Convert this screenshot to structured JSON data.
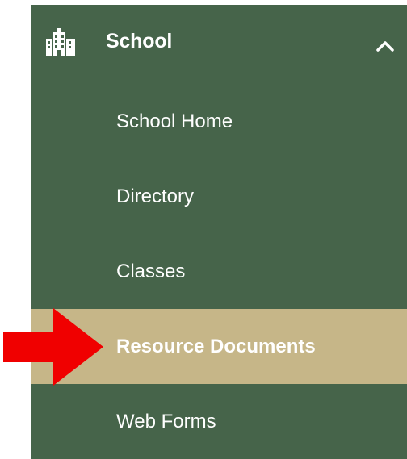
{
  "sidebar": {
    "section": {
      "title": "School",
      "icon": "building-icon",
      "expanded": true,
      "chevron": "chevron-up-icon"
    },
    "items": [
      {
        "label": "School Home",
        "active": false
      },
      {
        "label": "Directory",
        "active": false
      },
      {
        "label": "Classes",
        "active": false
      },
      {
        "label": "Resource Documents",
        "active": true
      },
      {
        "label": "Web Forms",
        "active": false
      }
    ]
  },
  "annotation": {
    "icon": "arrow-right-icon",
    "color": "#f00000"
  },
  "colors": {
    "panel": "#46644a",
    "active_item": "#c6b688",
    "text": "#ffffff"
  }
}
